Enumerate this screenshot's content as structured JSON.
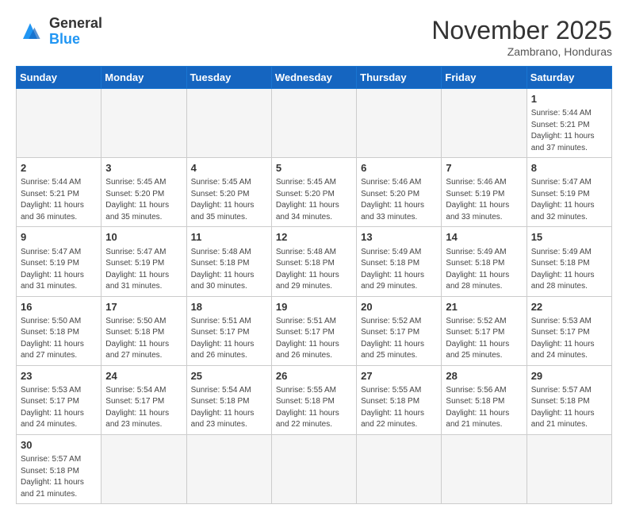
{
  "header": {
    "logo_general": "General",
    "logo_blue": "Blue",
    "month_title": "November 2025",
    "location": "Zambrano, Honduras"
  },
  "days_of_week": [
    "Sunday",
    "Monday",
    "Tuesday",
    "Wednesday",
    "Thursday",
    "Friday",
    "Saturday"
  ],
  "weeks": [
    [
      {
        "day": "",
        "info": ""
      },
      {
        "day": "",
        "info": ""
      },
      {
        "day": "",
        "info": ""
      },
      {
        "day": "",
        "info": ""
      },
      {
        "day": "",
        "info": ""
      },
      {
        "day": "",
        "info": ""
      },
      {
        "day": "1",
        "info": "Sunrise: 5:44 AM\nSunset: 5:21 PM\nDaylight: 11 hours\nand 37 minutes."
      }
    ],
    [
      {
        "day": "2",
        "info": "Sunrise: 5:44 AM\nSunset: 5:21 PM\nDaylight: 11 hours\nand 36 minutes."
      },
      {
        "day": "3",
        "info": "Sunrise: 5:45 AM\nSunset: 5:20 PM\nDaylight: 11 hours\nand 35 minutes."
      },
      {
        "day": "4",
        "info": "Sunrise: 5:45 AM\nSunset: 5:20 PM\nDaylight: 11 hours\nand 35 minutes."
      },
      {
        "day": "5",
        "info": "Sunrise: 5:45 AM\nSunset: 5:20 PM\nDaylight: 11 hours\nand 34 minutes."
      },
      {
        "day": "6",
        "info": "Sunrise: 5:46 AM\nSunset: 5:20 PM\nDaylight: 11 hours\nand 33 minutes."
      },
      {
        "day": "7",
        "info": "Sunrise: 5:46 AM\nSunset: 5:19 PM\nDaylight: 11 hours\nand 33 minutes."
      },
      {
        "day": "8",
        "info": "Sunrise: 5:47 AM\nSunset: 5:19 PM\nDaylight: 11 hours\nand 32 minutes."
      }
    ],
    [
      {
        "day": "9",
        "info": "Sunrise: 5:47 AM\nSunset: 5:19 PM\nDaylight: 11 hours\nand 31 minutes."
      },
      {
        "day": "10",
        "info": "Sunrise: 5:47 AM\nSunset: 5:19 PM\nDaylight: 11 hours\nand 31 minutes."
      },
      {
        "day": "11",
        "info": "Sunrise: 5:48 AM\nSunset: 5:18 PM\nDaylight: 11 hours\nand 30 minutes."
      },
      {
        "day": "12",
        "info": "Sunrise: 5:48 AM\nSunset: 5:18 PM\nDaylight: 11 hours\nand 29 minutes."
      },
      {
        "day": "13",
        "info": "Sunrise: 5:49 AM\nSunset: 5:18 PM\nDaylight: 11 hours\nand 29 minutes."
      },
      {
        "day": "14",
        "info": "Sunrise: 5:49 AM\nSunset: 5:18 PM\nDaylight: 11 hours\nand 28 minutes."
      },
      {
        "day": "15",
        "info": "Sunrise: 5:49 AM\nSunset: 5:18 PM\nDaylight: 11 hours\nand 28 minutes."
      }
    ],
    [
      {
        "day": "16",
        "info": "Sunrise: 5:50 AM\nSunset: 5:18 PM\nDaylight: 11 hours\nand 27 minutes."
      },
      {
        "day": "17",
        "info": "Sunrise: 5:50 AM\nSunset: 5:18 PM\nDaylight: 11 hours\nand 27 minutes."
      },
      {
        "day": "18",
        "info": "Sunrise: 5:51 AM\nSunset: 5:17 PM\nDaylight: 11 hours\nand 26 minutes."
      },
      {
        "day": "19",
        "info": "Sunrise: 5:51 AM\nSunset: 5:17 PM\nDaylight: 11 hours\nand 26 minutes."
      },
      {
        "day": "20",
        "info": "Sunrise: 5:52 AM\nSunset: 5:17 PM\nDaylight: 11 hours\nand 25 minutes."
      },
      {
        "day": "21",
        "info": "Sunrise: 5:52 AM\nSunset: 5:17 PM\nDaylight: 11 hours\nand 25 minutes."
      },
      {
        "day": "22",
        "info": "Sunrise: 5:53 AM\nSunset: 5:17 PM\nDaylight: 11 hours\nand 24 minutes."
      }
    ],
    [
      {
        "day": "23",
        "info": "Sunrise: 5:53 AM\nSunset: 5:17 PM\nDaylight: 11 hours\nand 24 minutes."
      },
      {
        "day": "24",
        "info": "Sunrise: 5:54 AM\nSunset: 5:17 PM\nDaylight: 11 hours\nand 23 minutes."
      },
      {
        "day": "25",
        "info": "Sunrise: 5:54 AM\nSunset: 5:18 PM\nDaylight: 11 hours\nand 23 minutes."
      },
      {
        "day": "26",
        "info": "Sunrise: 5:55 AM\nSunset: 5:18 PM\nDaylight: 11 hours\nand 22 minutes."
      },
      {
        "day": "27",
        "info": "Sunrise: 5:55 AM\nSunset: 5:18 PM\nDaylight: 11 hours\nand 22 minutes."
      },
      {
        "day": "28",
        "info": "Sunrise: 5:56 AM\nSunset: 5:18 PM\nDaylight: 11 hours\nand 21 minutes."
      },
      {
        "day": "29",
        "info": "Sunrise: 5:57 AM\nSunset: 5:18 PM\nDaylight: 11 hours\nand 21 minutes."
      }
    ],
    [
      {
        "day": "30",
        "info": "Sunrise: 5:57 AM\nSunset: 5:18 PM\nDaylight: 11 hours\nand 21 minutes."
      },
      {
        "day": "",
        "info": ""
      },
      {
        "day": "",
        "info": ""
      },
      {
        "day": "",
        "info": ""
      },
      {
        "day": "",
        "info": ""
      },
      {
        "day": "",
        "info": ""
      },
      {
        "day": "",
        "info": ""
      }
    ]
  ]
}
